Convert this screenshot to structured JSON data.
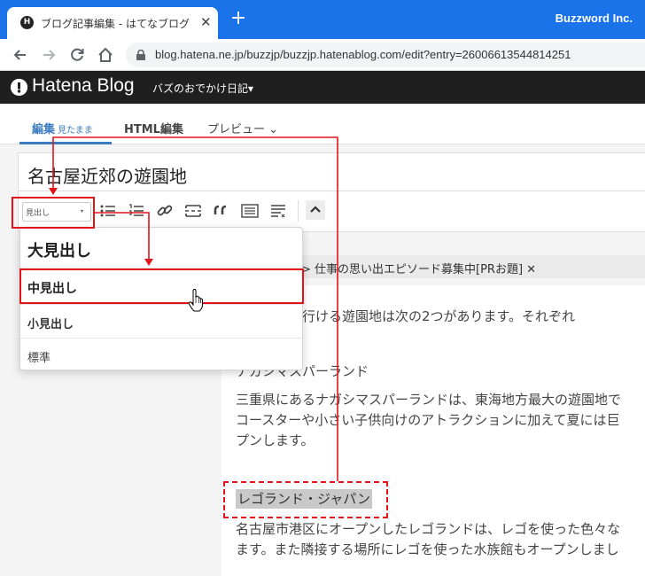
{
  "browser": {
    "tab_title": "ブログ記事編集 - はてなブログ",
    "tab_favicon_glyph": "H",
    "tab_close": "✕",
    "new_tab": "+",
    "profile": "Buzzword Inc.",
    "url": "blog.hatena.ne.jp/buzzjp/buzzjp.hatenablog.com/edit?entry=26006613544814251",
    "accent_color": "#1a73e8"
  },
  "hatena": {
    "logo": "Hatena Blog",
    "blog_name": "バズのおでかけ日記▾"
  },
  "editor": {
    "tabs": [
      {
        "label": "編集",
        "sub": "見たまま"
      },
      {
        "label": "HTML編集"
      },
      {
        "label": "プレビュー",
        "chevron": "⌄"
      }
    ],
    "title": "名古屋近郊の遊園地",
    "format_select": {
      "value": "見出し",
      "caret": "▾"
    },
    "toolbar_icons": [
      "bullet-list-icon",
      "numbered-list-icon",
      "link-icon",
      "page-break-icon",
      "blockquote-icon",
      "table-of-contents-icon",
      "more-format-icon",
      "collapse-icon"
    ],
    "category_notice": "> 仕事の思い出エピソード募集中[PRお題] ✕",
    "body": {
      "line1": "から手軽に行ける遊園地は次の2つがあります。それぞれ",
      "heading1": "ナガシマスパーランド",
      "para1_line1": "三重県にあるナガシマスパーランドは、東海地方最大の遊園地で",
      "para1_line2": "コースターや小さい子供向けのアトラクションに加えて夏には巨",
      "para1_line3": "プンします。",
      "heading2": "レゴランド・ジャパン",
      "para2_line1": "名古屋市港区にオープンしたレゴランドは、レゴを使った色々な",
      "para2_line2": "ます。また隣接する場所にレゴを使った水族館もオープンしまし"
    }
  },
  "dropdown": {
    "items": [
      {
        "label": "大見出し"
      },
      {
        "label": "中見出し"
      },
      {
        "label": "小見出し"
      },
      {
        "label": "標準"
      }
    ]
  },
  "annotation_color": "#e2141b"
}
